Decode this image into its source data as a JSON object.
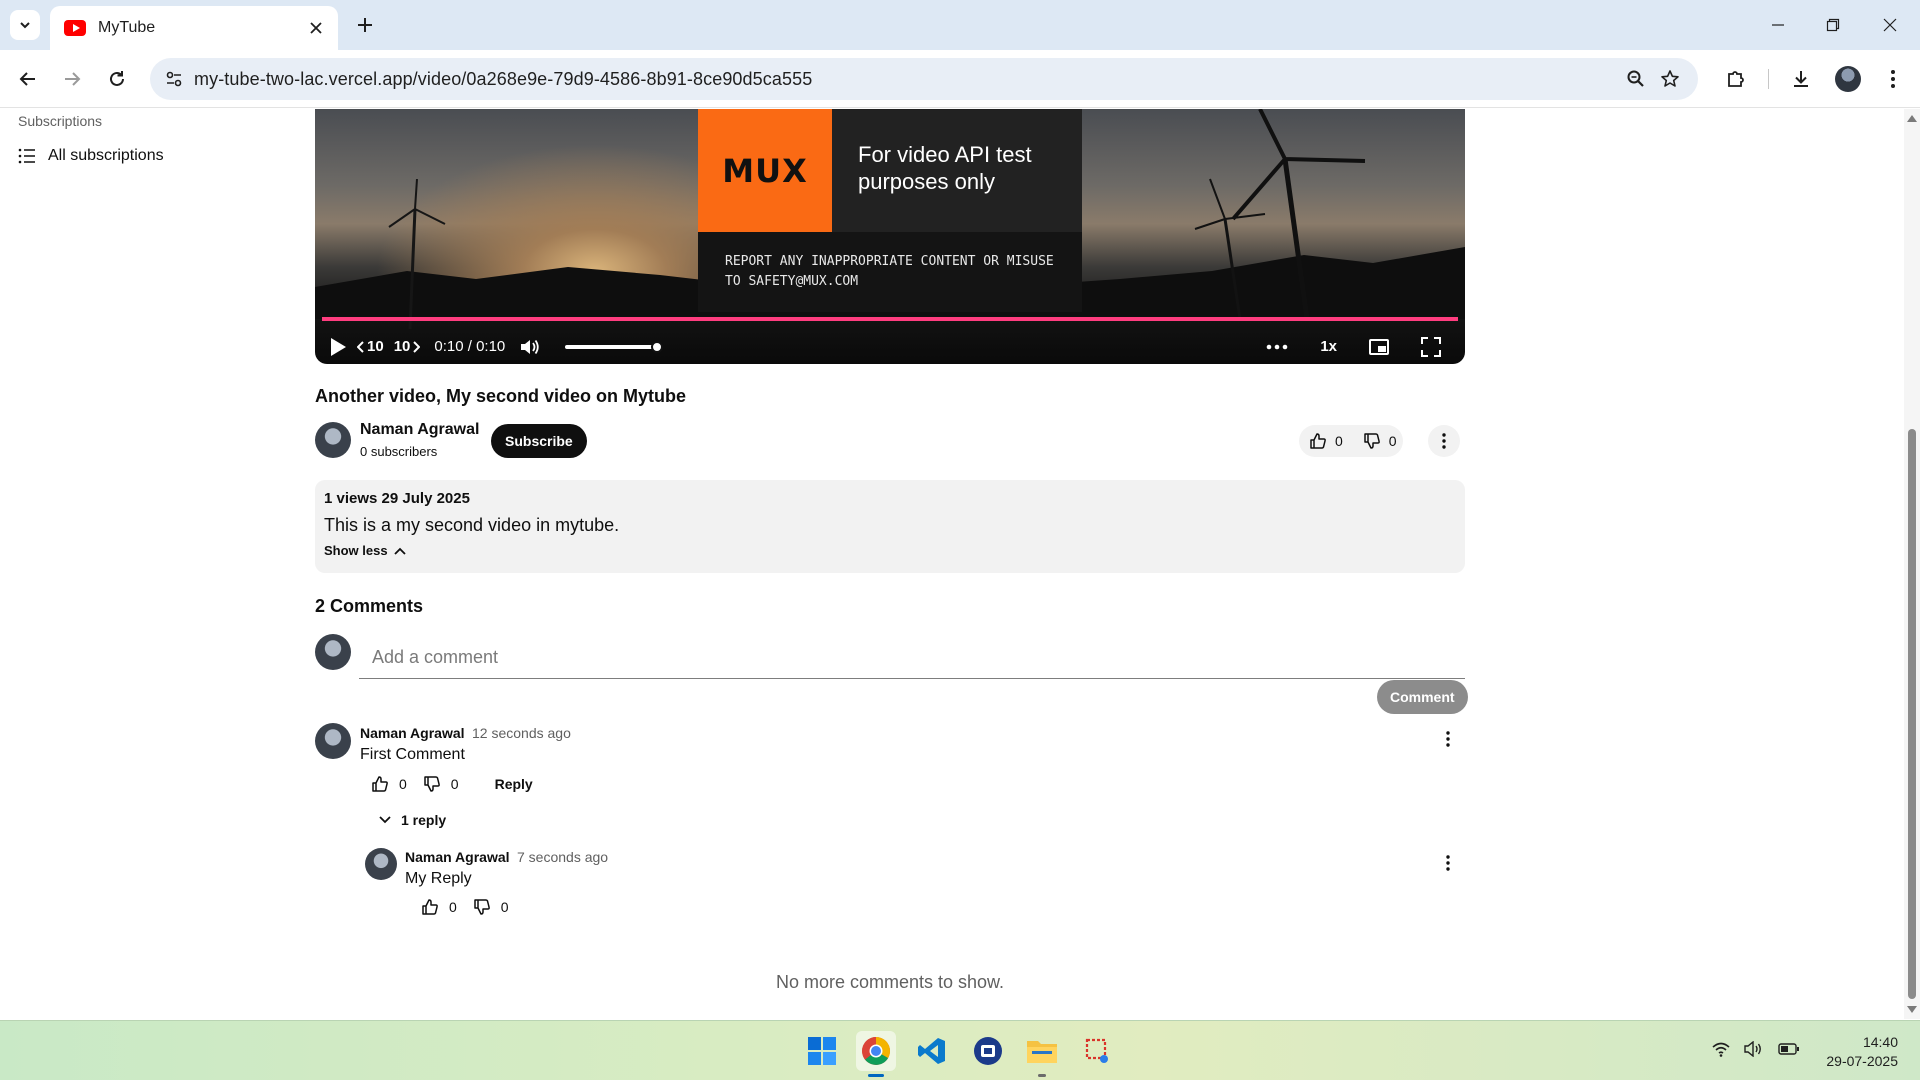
{
  "browser": {
    "tab_title": "MyTube",
    "url": "my-tube-two-lac.vercel.app/video/0a268e9e-79d9-4586-8b91-8ce90d5ca555"
  },
  "sidebar": {
    "section_title": "Subscriptions",
    "all_subscriptions": "All subscriptions"
  },
  "player": {
    "promo_logo": "MUX",
    "promo_text": "For video API test purposes only",
    "promo_report": "REPORT ANY INAPPROPRIATE CONTENT OR MISUSE TO SAFETY@MUX.COM",
    "rewind_label": "10",
    "forward_label": "10",
    "time": "0:10 / 0:10",
    "speed": "1x",
    "progress_percent": 100,
    "volume_percent": 100,
    "progress_color": "#ff3d7f"
  },
  "video": {
    "title": "Another video, My second video on Mytube",
    "channel_name": "Naman Agrawal",
    "subscribers": "0 subscribers",
    "subscribe_label": "Subscribe",
    "likes": "0",
    "dislikes": "0",
    "meta": "1 views 29 July 2025",
    "description": "This is a my second video in mytube.",
    "show_less": "Show less"
  },
  "comments": {
    "title": "2 Comments",
    "placeholder": "Add a comment",
    "submit_label": "Comment",
    "items": [
      {
        "author": "Naman Agrawal",
        "time": "12 seconds ago",
        "text": "First Comment",
        "likes": "0",
        "dislikes": "0",
        "reply_label": "Reply",
        "replies_label": "1 reply",
        "replies": [
          {
            "author": "Naman Agrawal",
            "time": "7 seconds ago",
            "text": "My Reply",
            "likes": "0",
            "dislikes": "0"
          }
        ]
      }
    ],
    "end_text": "No more comments to show."
  },
  "taskbar": {
    "time": "14:40",
    "date": "29-07-2025",
    "apps": [
      "windows-start-icon",
      "chrome-icon",
      "vscode-icon",
      "teams-icon",
      "file-explorer-icon",
      "snipping-tool-icon"
    ]
  }
}
